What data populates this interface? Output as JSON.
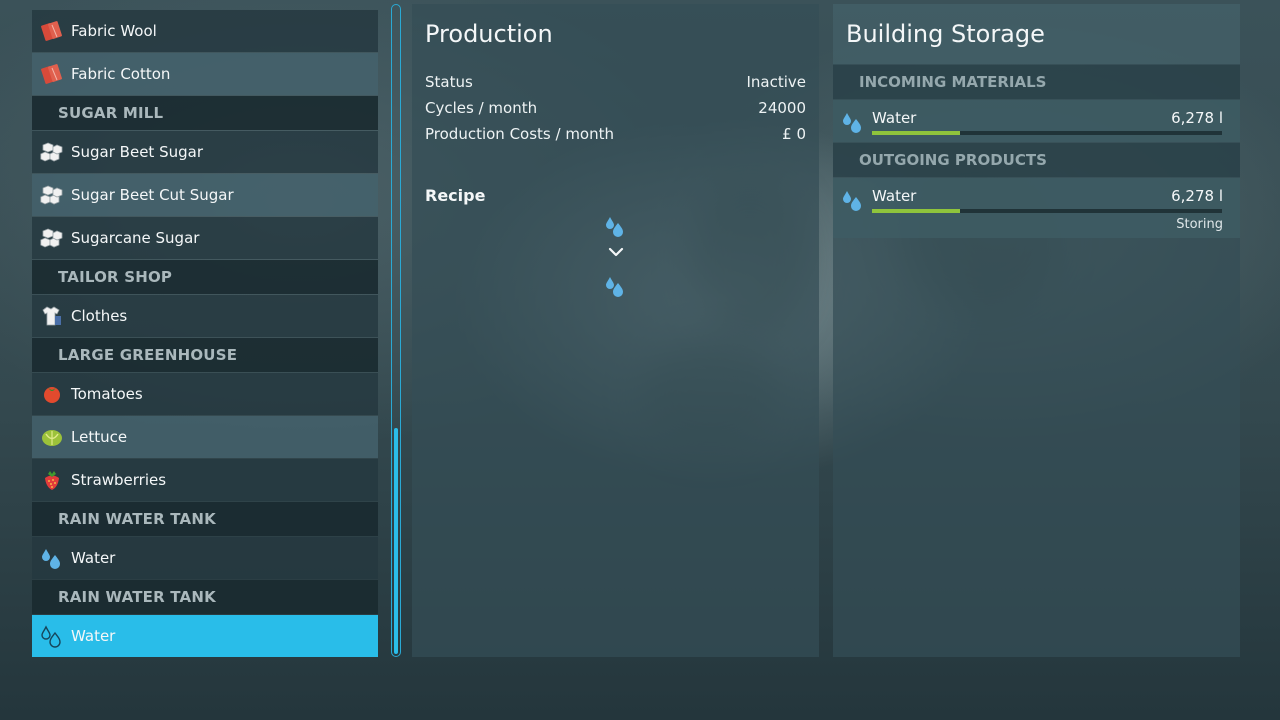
{
  "list": {
    "rows": [
      {
        "type": "item",
        "label": "Fabric Wool",
        "icon": "fabric-icon",
        "alt": false
      },
      {
        "type": "item",
        "label": "Fabric Cotton",
        "icon": "fabric-icon",
        "alt": true
      },
      {
        "type": "header",
        "label": "SUGAR MILL"
      },
      {
        "type": "item",
        "label": "Sugar Beet Sugar",
        "icon": "sugar-cubes-icon",
        "alt": false
      },
      {
        "type": "item",
        "label": "Sugar Beet Cut Sugar",
        "icon": "sugar-cubes-icon",
        "alt": true
      },
      {
        "type": "item",
        "label": "Sugarcane Sugar",
        "icon": "sugar-cubes-icon",
        "alt": false
      },
      {
        "type": "header",
        "label": "TAILOR SHOP"
      },
      {
        "type": "item",
        "label": "Clothes",
        "icon": "clothes-icon",
        "alt": false
      },
      {
        "type": "header",
        "label": "LARGE GREENHOUSE"
      },
      {
        "type": "item",
        "label": "Tomatoes",
        "icon": "tomato-icon",
        "alt": false
      },
      {
        "type": "item",
        "label": "Lettuce",
        "icon": "lettuce-icon",
        "alt": true
      },
      {
        "type": "item",
        "label": "Strawberries",
        "icon": "strawberry-icon",
        "alt": false
      },
      {
        "type": "header",
        "label": "RAIN WATER TANK"
      },
      {
        "type": "item",
        "label": "Water",
        "icon": "water-drops-icon",
        "alt": false
      },
      {
        "type": "header",
        "label": "RAIN WATER TANK"
      },
      {
        "type": "item",
        "label": "Water",
        "icon": "water-drops-icon",
        "alt": false,
        "selected": true
      }
    ]
  },
  "production": {
    "title": "Production",
    "status_label": "Status",
    "status_value": "Inactive",
    "cycles_label": "Cycles / month",
    "cycles_value": "24000",
    "costs_label": "Production Costs / month",
    "costs_value": "£ 0",
    "recipe_label": "Recipe"
  },
  "storage": {
    "title": "Building Storage",
    "incoming_header": "INCOMING MATERIALS",
    "incoming": {
      "name": "Water",
      "amount": "6,278 l",
      "fill": 0.25
    },
    "outgoing_header": "OUTGOING PRODUCTS",
    "outgoing": {
      "name": "Water",
      "amount": "6,278 l",
      "fill": 0.25,
      "status": "Storing"
    }
  },
  "colors": {
    "selected": "#29bde9",
    "bar_fill": "#8fc43c",
    "water": "#5fb3e6"
  }
}
